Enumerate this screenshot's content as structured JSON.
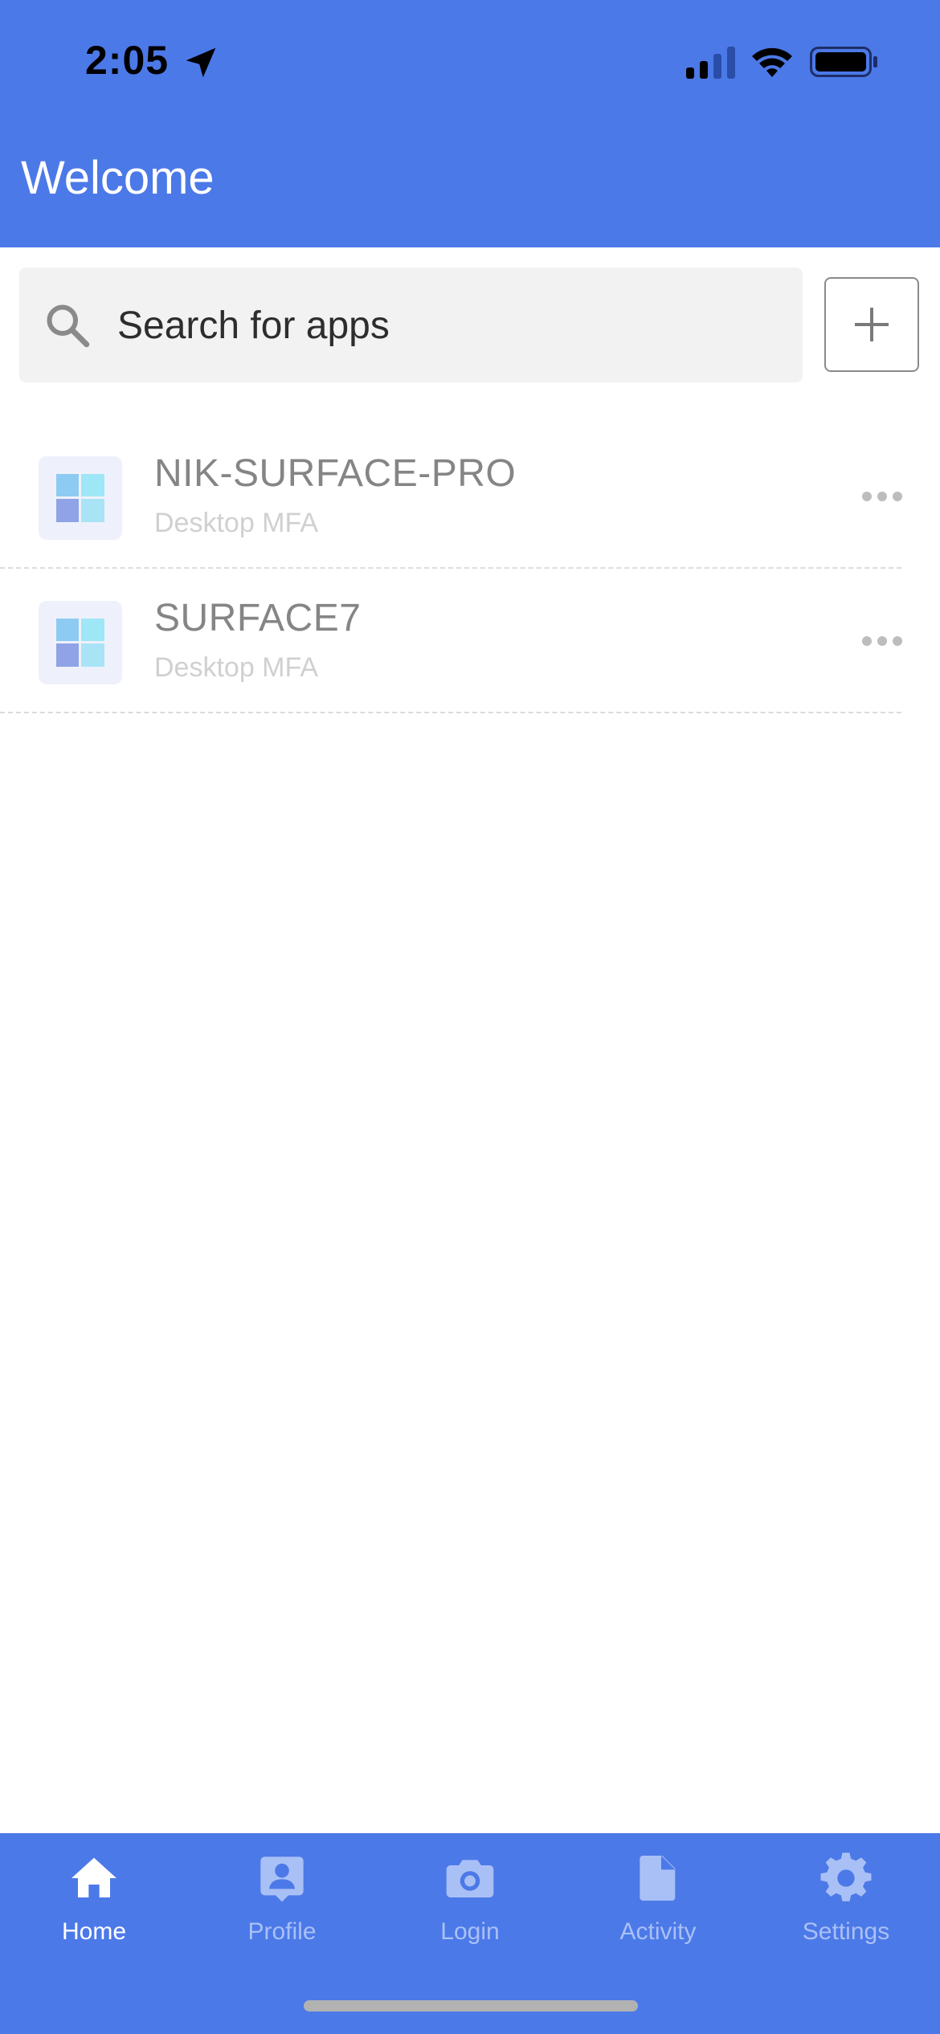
{
  "status_bar": {
    "time": "2:05",
    "icons": [
      "location-arrow-icon",
      "cellular-signal-icon",
      "wifi-icon",
      "battery-icon"
    ]
  },
  "header": {
    "title": "Welcome"
  },
  "search": {
    "placeholder": "Search for apps",
    "value": ""
  },
  "apps": [
    {
      "name": "NIK-SURFACE-PRO",
      "subtitle": "Desktop MFA",
      "icon": "windows-logo-icon"
    },
    {
      "name": "SURFACE7",
      "subtitle": "Desktop MFA",
      "icon": "windows-logo-icon"
    }
  ],
  "tabs": [
    {
      "label": "Home",
      "icon": "home-icon",
      "active": true
    },
    {
      "label": "Profile",
      "icon": "profile-icon",
      "active": false
    },
    {
      "label": "Login",
      "icon": "camera-icon",
      "active": false
    },
    {
      "label": "Activity",
      "icon": "document-icon",
      "active": false
    },
    {
      "label": "Settings",
      "icon": "gear-icon",
      "active": false
    }
  ],
  "colors": {
    "primary": "#4c79e8",
    "tab_active": "#ffffff",
    "tab_inactive": "#a9c0f6"
  }
}
